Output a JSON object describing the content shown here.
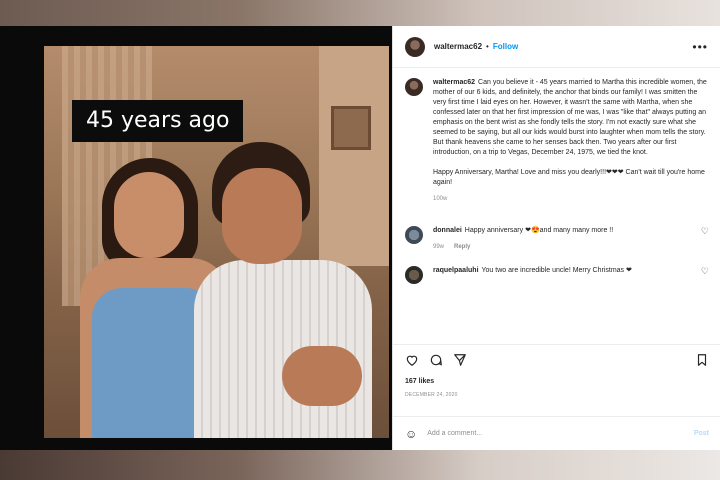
{
  "post": {
    "username": "waltermac62",
    "follow_label": "Follow",
    "more_icon": "more-icon",
    "image_caption": "45 years ago",
    "caption": {
      "username": "waltermac62",
      "text": "Can you believe it - 45 years married to Martha this incredible women, the mother of our 6 kids, and definitely, the anchor that binds our family! I was smitten the very first time I laid eyes on her. However, it wasn't the same with Martha, when she confessed later on that her first impression of me was, I was \"like that\" always putting an emphasis on the bent wrist as she fondly tells the story. I'm not exactly sure what she seemed to be saying, but all our kids would burst into laughter when mom tells the story. But thank heavens she came to her senses back then. Two years after our first introduction, on a trip to Vegas, December 24, 1975, we tied the knot.",
      "text2": "Happy Anniversary, Martha! Love and miss you dearly!!!❤❤❤ Can't wait till you're home again!",
      "time": "100w"
    },
    "comments": [
      {
        "username": "donnalei",
        "text": "Happy anniversary ❤😍and many many more !!",
        "time": "99w",
        "reply": "Reply"
      },
      {
        "username": "raquelpaaluhi",
        "text": "You two are incredible uncle! Merry Christmas ❤",
        "time": "",
        "reply": ""
      }
    ],
    "likes": "167 likes",
    "date": "DECEMBER 24, 2020",
    "add_comment_placeholder": "Add a comment...",
    "post_button": "Post"
  },
  "colors": {
    "link": "#0095f6",
    "heart": "#ed4956"
  }
}
